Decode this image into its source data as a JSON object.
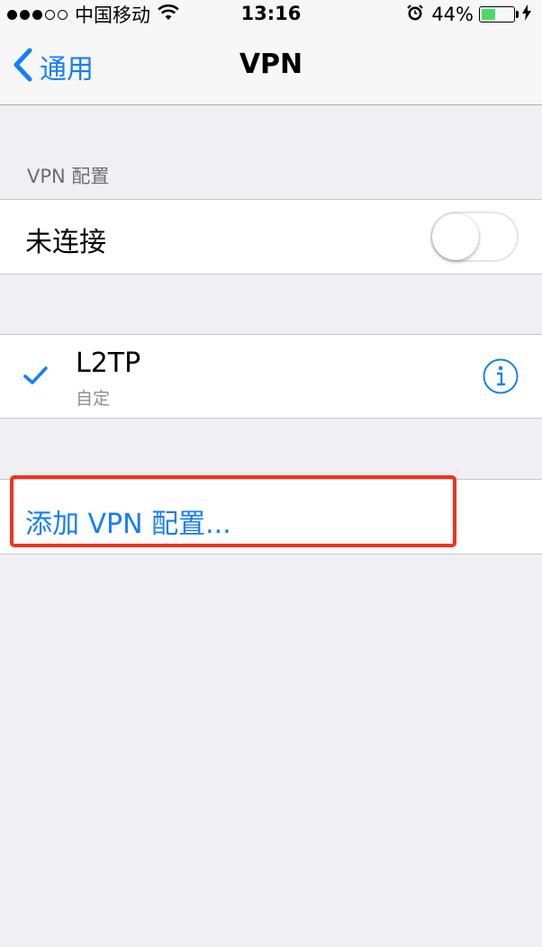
{
  "status_bar": {
    "carrier": "中国移动",
    "signal_filled": 3,
    "signal_total": 5,
    "time": "13:16",
    "battery_percent": "44%",
    "battery_level": 0.44,
    "icons": [
      "wifi-icon",
      "alarm-icon",
      "battery-icon",
      "charging-icon"
    ]
  },
  "navbar": {
    "back_label": "通用",
    "title": "VPN"
  },
  "vpn_config": {
    "section_header": "VPN 配置",
    "status_label": "未连接",
    "toggle_on": false
  },
  "vpn_list": [
    {
      "name": "L2TP",
      "type": "自定",
      "selected": true
    }
  ],
  "add_vpn": {
    "label": "添加 VPN 配置..."
  },
  "colors": {
    "accent": "#157efb",
    "background": "#efeff4",
    "highlight": "#f5311f",
    "battery": "#4cd964"
  }
}
